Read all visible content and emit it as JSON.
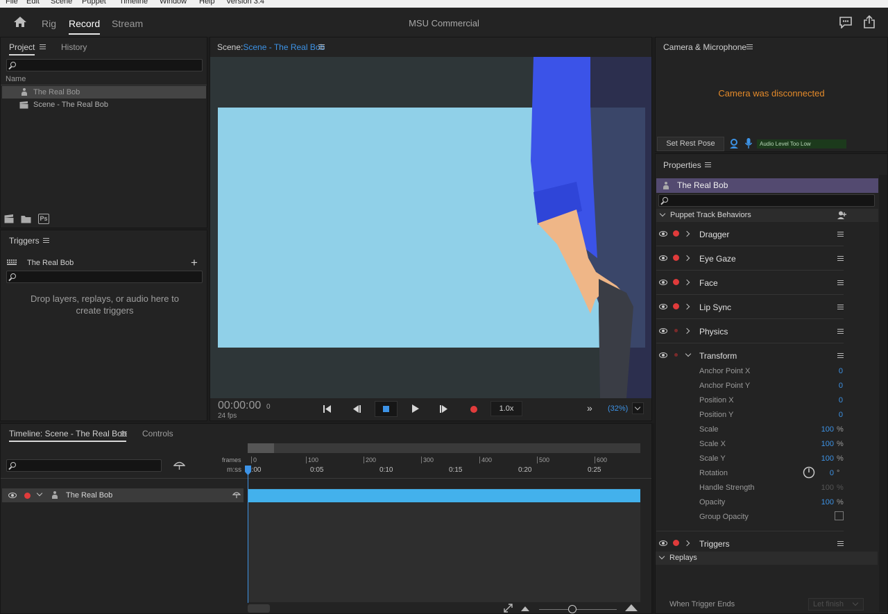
{
  "menu": [
    "File",
    "Edit",
    "Scene",
    "Puppet",
    "Timeline",
    "Window",
    "Help",
    "Version 3.4"
  ],
  "modes": [
    {
      "label": "Rig"
    },
    {
      "label": "Record",
      "active": true
    },
    {
      "label": "Stream"
    }
  ],
  "project_title": "MSU Commercial",
  "project_panel": {
    "tabs": [
      "Project",
      "History"
    ],
    "column": "Name",
    "items": [
      "The Real Bob",
      "Scene - The Real Bob"
    ],
    "footer_ps": "Ps"
  },
  "triggers_panel": {
    "title": "Triggers",
    "puppet": "The Real Bob",
    "drop_text": "Drop layers, replays, or audio here to create triggers"
  },
  "scene_panel": {
    "label": "Scene:",
    "scene_name": "Scene - The Real Bob",
    "timecode": "00:00:00",
    "frame": "0",
    "fps": "24 fps",
    "speed": "1.0x",
    "zoom": "(32%)"
  },
  "camera_panel": {
    "title": "Camera & Microphone",
    "message": "Camera was disconnected",
    "rest_pose": "Set Rest Pose",
    "audio_level": "Audio Level Too Low"
  },
  "properties_panel": {
    "title": "Properties",
    "puppet": "The Real Bob",
    "section": "Puppet Track Behaviors",
    "behaviors": [
      "Dragger",
      "Eye Gaze",
      "Face",
      "Lip Sync",
      "Physics",
      "Transform"
    ],
    "transform_props": [
      {
        "label": "Anchor Point X",
        "value": "0",
        "unit": ""
      },
      {
        "label": "Anchor Point Y",
        "value": "0",
        "unit": ""
      },
      {
        "label": "Position X",
        "value": "0",
        "unit": ""
      },
      {
        "label": "Position Y",
        "value": "0",
        "unit": ""
      },
      {
        "label": "Scale",
        "value": "100",
        "unit": "%"
      },
      {
        "label": "Scale X",
        "value": "100",
        "unit": "%"
      },
      {
        "label": "Scale Y",
        "value": "100",
        "unit": "%"
      },
      {
        "label": "Rotation",
        "value": "0",
        "unit": "°"
      },
      {
        "label": "Handle Strength",
        "value": "100",
        "unit": "%"
      },
      {
        "label": "Opacity",
        "value": "100",
        "unit": "%"
      },
      {
        "label": "Group Opacity",
        "value": "",
        "unit": ""
      }
    ],
    "triggers": "Triggers",
    "replays": "Replays",
    "when_trigger_ends": "When Trigger Ends",
    "let_finish": "Let finish"
  },
  "timeline_panel": {
    "tabs": [
      "Timeline: Scene - The Real Bob",
      "Controls"
    ],
    "frames_label": "frames",
    "mss_label": "m:ss",
    "frame_ticks": [
      "0",
      "100",
      "200",
      "300",
      "400",
      "500",
      "600"
    ],
    "time_ticks": [
      "0:00",
      "0:05",
      "0:10",
      "0:15",
      "0:20",
      "0:25"
    ],
    "track": "The Real Bob"
  }
}
